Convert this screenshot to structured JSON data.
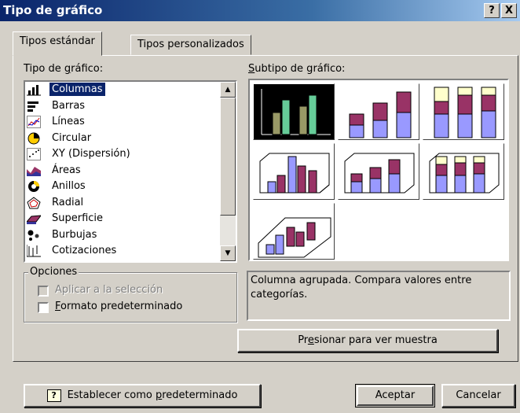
{
  "window": {
    "title": "Tipo de gráfico",
    "help_glyph": "?",
    "close_glyph": "X"
  },
  "tabs": [
    {
      "label": "Tipos estándar",
      "active": true
    },
    {
      "label": "Tipos personalizados",
      "active": false
    }
  ],
  "chart_type": {
    "label": "Tipo de gráfico:",
    "items": [
      {
        "label": "Columnas",
        "icon": "column-chart-icon",
        "selected": true
      },
      {
        "label": "Barras",
        "icon": "bar-chart-icon"
      },
      {
        "label": "Líneas",
        "icon": "line-chart-icon"
      },
      {
        "label": "Circular",
        "icon": "pie-chart-icon"
      },
      {
        "label": "XY (Dispersión)",
        "icon": "scatter-chart-icon"
      },
      {
        "label": "Áreas",
        "icon": "area-chart-icon"
      },
      {
        "label": "Anillos",
        "icon": "doughnut-chart-icon"
      },
      {
        "label": "Radial",
        "icon": "radar-chart-icon"
      },
      {
        "label": "Superficie",
        "icon": "surface-chart-icon"
      },
      {
        "label": "Burbujas",
        "icon": "bubble-chart-icon"
      },
      {
        "label": "Cotizaciones",
        "icon": "stock-chart-icon"
      }
    ],
    "scroll_up_glyph": "▲",
    "scroll_down_glyph": "▼"
  },
  "subtype": {
    "label": "Subtipo de gráfico:",
    "selected_index": 0,
    "count": 7
  },
  "options": {
    "legend": "Opciones",
    "apply_selection": {
      "label": "Aplicar a la selección",
      "enabled": false,
      "checked": false
    },
    "default_format": {
      "label": "Formato predeterminado",
      "enabled": true,
      "checked": false
    }
  },
  "description": "Columna agrupada. Compara valores entre categorías.",
  "buttons": {
    "preview": "Presionar para ver muestra",
    "set_default": "Establecer como predeterminado",
    "ok": "Aceptar",
    "cancel": "Cancelar"
  },
  "colors": {
    "series1": "#9999ff",
    "series2": "#993366",
    "series3": "#ffffcc",
    "selected_green": "#66cc99",
    "selected_olive": "#999966",
    "highlight": "#0a246a"
  }
}
